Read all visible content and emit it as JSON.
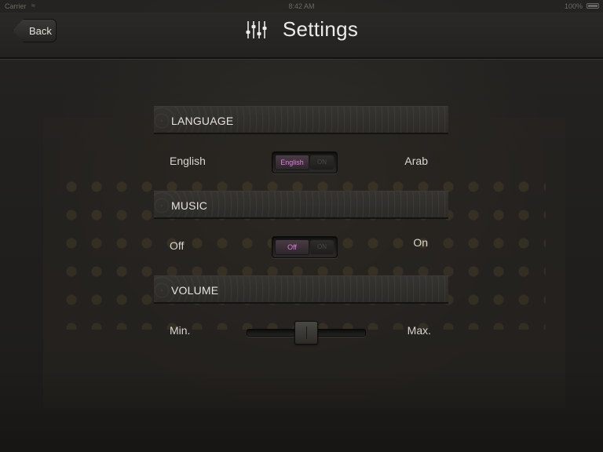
{
  "status_bar": {
    "carrier": "Carrier",
    "wifi_icon": "wifi-icon",
    "time": "8:42 AM",
    "battery_percent": "100%"
  },
  "nav": {
    "back_label": "Back",
    "title": "Settings",
    "title_icon": "sliders-icon"
  },
  "sections": {
    "language": {
      "header": "LANGUAGE",
      "left_label": "English",
      "right_label": "Arab",
      "toggle_selected": "English",
      "toggle_other": "ON"
    },
    "music": {
      "header": "MUSIC",
      "left_label": "Off",
      "right_label": "On",
      "toggle_selected": "Off",
      "toggle_other": "ON"
    },
    "volume": {
      "header": "VOLUME",
      "left_label": "Min.",
      "right_label": "Max.",
      "level": 0.5
    }
  },
  "colors": {
    "toggle_accent": "#e07ce0",
    "background": "#1e1d1b"
  }
}
